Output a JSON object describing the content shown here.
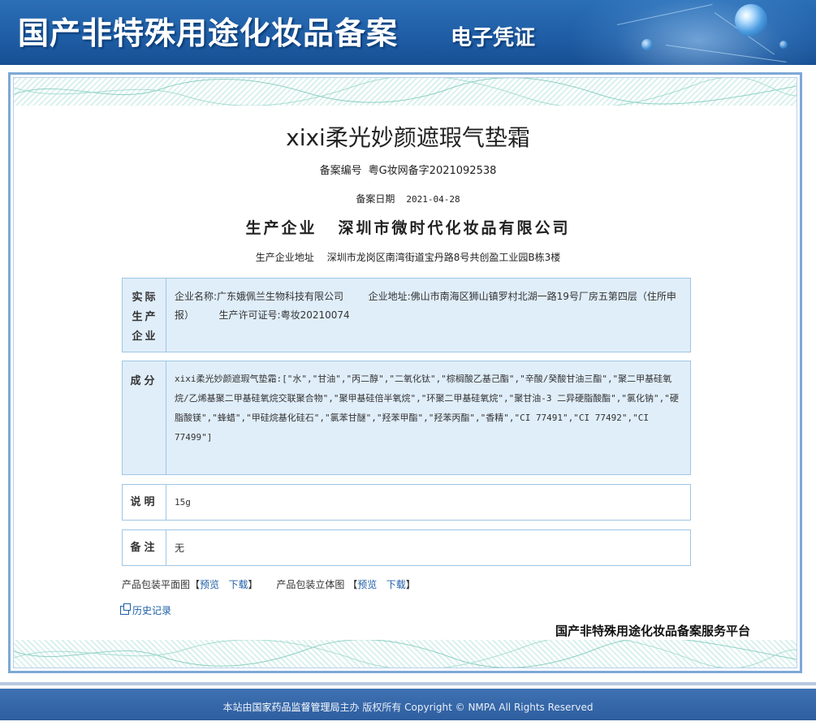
{
  "header": {
    "title": "国产非特殊用途化妆品备案",
    "subtitle": "电子凭证"
  },
  "product": {
    "name": "xixi柔光妙颜遮瑕气垫霜",
    "record_no_label": "备案编号",
    "record_no": "粤G妆网备字2021092538",
    "record_date_label": "备案日期",
    "record_date": "2021-04-28",
    "producer_label": "生产企业",
    "producer": "深圳市微时代化妆品有限公司",
    "producer_addr_label": "生产企业地址",
    "producer_addr": "深圳市龙岗区南湾街道宝丹路8号共创盈工业园B栋3楼"
  },
  "actual_producer": {
    "head": "实际生产企业",
    "name_label": "企业名称:",
    "name": "广东娥佩兰生物科技有限公司",
    "addr_label": "企业地址:",
    "addr": "佛山市南海区狮山镇罗村北湖一路19号厂房五第四层（住所申报）",
    "license_label": "生产许可证号:",
    "license": "粤妆20210074"
  },
  "ingredients": {
    "head": "成分",
    "text": "xixi柔光妙颜遮瑕气垫霜:[\"水\",\"甘油\",\"丙二醇\",\"二氧化钛\",\"棕榈酸乙基己酯\",\"辛酸/癸酸甘油三酯\",\"聚二甲基硅氧烷/乙烯基聚二甲基硅氧烷交联聚合物\",\"聚甲基硅倍半氧烷\",\"环聚二甲基硅氧烷\",\"聚甘油-3 二异硬脂酸酯\",\"氯化钠\",\"硬脂酸镁\",\"蜂蜡\",\"甲硅烷基化硅石\",\"氯苯甘醚\",\"羟苯甲酯\",\"羟苯丙酯\",\"香精\",\"CI 77491\",\"CI 77492\",\"CI 77499\"]"
  },
  "description": {
    "head": "说明",
    "text": "15g"
  },
  "remark": {
    "head": "备注",
    "text": "无"
  },
  "package": {
    "flat_label": "产品包装平面图",
    "solid_label": "产品包装立体图",
    "bracket_open": "【",
    "bracket_close": "】",
    "preview": "预览",
    "download": "下载"
  },
  "history": "历史记录",
  "platform": "国产非特殊用途化妆品备案服务平台",
  "footer": {
    "prefix": "本站由",
    "org": "国家药品监督管理局",
    "suffix": "主办 版权所有 Copyright © NMPA All Rights Reserved"
  },
  "colors": {
    "header_blue": "#1f5ea6",
    "box_fill": "#e0eefa",
    "box_border": "#9fc6e4",
    "link": "#1e5fa8"
  }
}
